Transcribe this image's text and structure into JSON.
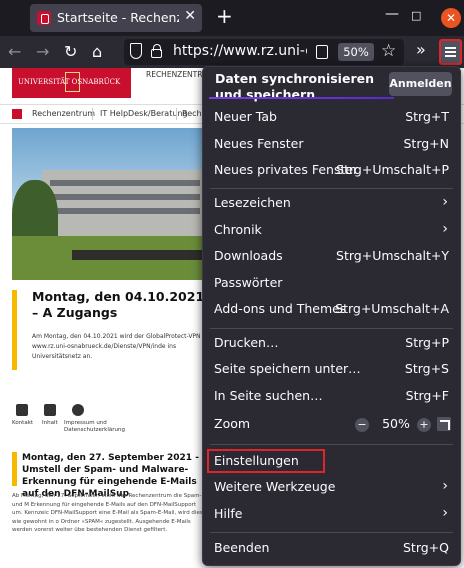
{
  "browser": {
    "tab_title": "Startseite - Rechenzentrum",
    "url": "https://www.rz.uni-osnabrueck.de",
    "zoom_badge": "50%"
  },
  "page": {
    "logo_text": "UNIVERSITÄT OSNABRÜCK",
    "top_label": "RECHENZENTRUM",
    "breadcrumb": [
      "Rechenzentrum",
      "IT HelpDesk/Beratung",
      "Reche"
    ],
    "headline": "Montag, den 04.10.2021 – A Zugangs",
    "teaser": "Am Montag, den 04.10.2021 wird der GlobalProtect-VPN www.rz.uni-osnabrueck.de/Dienste/VPN/inde ins Universitätsnetz an.",
    "icons": [
      {
        "icon": "mail-icon",
        "label": "Kontakt"
      },
      {
        "icon": "sitemap-icon",
        "label": "Inhalt"
      },
      {
        "icon": "info-icon",
        "label": "Impressum und Datenschutzerklärung"
      }
    ],
    "news2_title": "Montag, den 27. September 2021 - Umstell der Spam- und Malware-Erkennung für eingehende E-Mails auf den DFN-MailSup",
    "news2_text": "Ab Montag, den 27. September, stellt das Rechenzentrum die Spam- und M Erkennung für eingehende E-Mails auf den DFN-MailSupport um. Kennzeic DFN-MailSupport eine E-Mail als Spam-E-Mail, wird diese wie gewohnt in o Ordner »SPAM« zugestellt. Ausgehende E-Mails werden vorerst weiter übe bestehenden Dienst gefiltert."
  },
  "menu": {
    "sync_title": "Daten synchronisieren und speichern",
    "signin": "Anmelden",
    "new_tab": "Neuer Tab",
    "new_tab_sc": "Strg+T",
    "new_window": "Neues Fenster",
    "new_window_sc": "Strg+N",
    "private_window": "Neues privates Fenster",
    "private_window_sc": "Strg+Umschalt+P",
    "bookmarks": "Lesezeichen",
    "history": "Chronik",
    "downloads": "Downloads",
    "downloads_sc": "Strg+Umschalt+Y",
    "passwords": "Passwörter",
    "addons": "Add-ons und Themes",
    "addons_sc": "Strg+Umschalt+A",
    "print": "Drucken…",
    "print_sc": "Strg+P",
    "save_page": "Seite speichern unter…",
    "save_page_sc": "Strg+S",
    "find": "In Seite suchen…",
    "find_sc": "Strg+F",
    "zoom": "Zoom",
    "zoom_value": "50%",
    "zoom_minus": "−",
    "zoom_plus": "+",
    "settings": "Einstellungen",
    "more_tools": "Weitere Werkzeuge",
    "help": "Hilfe",
    "quit": "Beenden",
    "quit_sc": "Strg+Q"
  },
  "colors": {
    "accent": "#e0242a",
    "brand": "#c8102e",
    "menu_bg": "#2b2a33"
  }
}
